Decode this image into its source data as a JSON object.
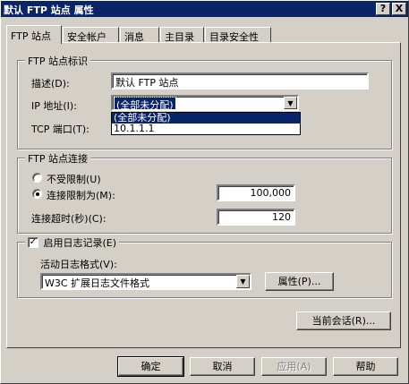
{
  "window": {
    "title": "默认 FTP 站点 属性",
    "help_button": "?",
    "close_button": "X"
  },
  "tabs": [
    {
      "label": "FTP 站点",
      "active": true
    },
    {
      "label": "安全帐户"
    },
    {
      "label": "消息"
    },
    {
      "label": "主目录"
    },
    {
      "label": "目录安全性"
    }
  ],
  "identification": {
    "legend": "FTP 站点标识",
    "description_label": "描述(D):",
    "description_value": "默认 FTP 站点",
    "ip_label": "IP 地址(I):",
    "ip_value": "(全部未分配)",
    "ip_options": [
      "(全部未分配)",
      "10.1.1.1"
    ],
    "tcp_label": "TCP 端口(T):"
  },
  "connection": {
    "legend": "FTP 站点连接",
    "unlimited_label": "不受限制(U)",
    "limited_label": "连接限制为(M):",
    "limit_value": "100,000",
    "timeout_label": "连接超时(秒)(C):",
    "timeout_value": "120"
  },
  "logging": {
    "enable_label": "启用日志记录(E)",
    "enabled": true,
    "format_label": "活动日志格式(V):",
    "format_value": "W3C 扩展日志文件格式",
    "properties_button": "属性(P)..."
  },
  "current_sessions_button": "当前会话(R)...",
  "footer": {
    "ok": "确定",
    "cancel": "取消",
    "apply": "应用(A)",
    "help": "帮助"
  }
}
